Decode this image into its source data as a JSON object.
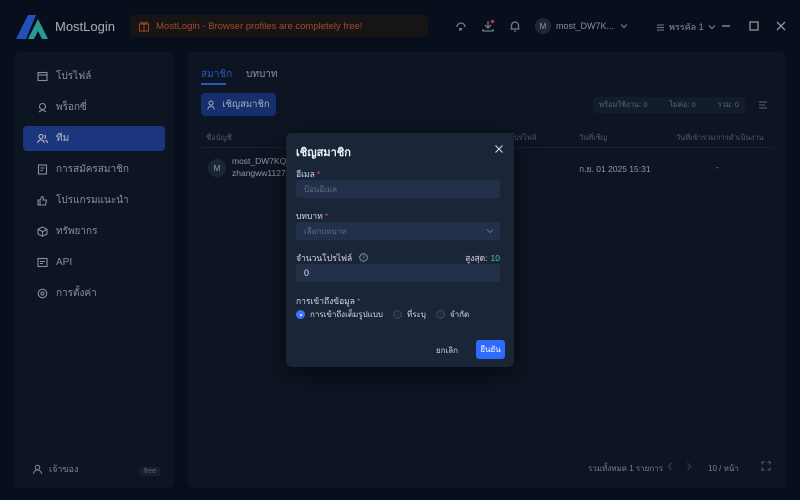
{
  "app": {
    "name": "MostLogin"
  },
  "banner": {
    "text": "MostLogin - Browser profiles are completely free!"
  },
  "topbar": {
    "user": "most_DW7K...",
    "user_initial": "M",
    "workspace": "พรรคัล 1"
  },
  "sidebar": {
    "items": [
      {
        "label": "โปรไฟล์",
        "icon": "window-icon"
      },
      {
        "label": "พร็อกซี่",
        "icon": "proxy-icon"
      },
      {
        "label": "ทีม",
        "icon": "team-icon"
      },
      {
        "label": "การสมัครสมาชิก",
        "icon": "subscription-icon"
      },
      {
        "label": "โปรแกรมแนะนำ",
        "icon": "thumbs-up-icon"
      },
      {
        "label": "ทรัพยากร",
        "icon": "cube-icon"
      },
      {
        "label": "API",
        "icon": "api-icon"
      },
      {
        "label": "การตั้งค่า",
        "icon": "gear-icon"
      }
    ],
    "active_index": 2,
    "owner": "เจ้าของ",
    "plan": "free"
  },
  "main": {
    "tabs": [
      {
        "label": "สมาชิก"
      },
      {
        "label": "บทบาท"
      }
    ],
    "invite_label": "เชิญสมาชิก",
    "stats": {
      "online": "พร้อมใช้งาน: 0",
      "offline": "ไม่ต่อ: 0",
      "total": "รวม: 0"
    },
    "columns": [
      "ชื่อบัญชี",
      "โปรไฟล์",
      "วันที่เชิญ",
      "วันที่เข้าร่วม",
      "การดำเนินงาน"
    ],
    "rows": [
      {
        "initial": "M",
        "name": "most_DW7KQ",
        "email": "zhangww1127",
        "invited": "ก.ย. 01 2025 15:31",
        "action": "-"
      }
    ],
    "footer": {
      "total": "รวมทั้งหมด 1 รายการ",
      "page_size": "10 / หน้า"
    }
  },
  "modal": {
    "title": "เชิญสมาชิก",
    "email": {
      "label": "อีเมล",
      "placeholder": "ป้อนอีเมล"
    },
    "role": {
      "label": "บทบาท",
      "placeholder": "เลือกบทบาท"
    },
    "profile_count": {
      "label": "จำนวนโปรไฟล์",
      "value": "0",
      "max_label": "สูงสุด:",
      "max_value": "10"
    },
    "access": {
      "label": "การเข้าถึงข้อมูล",
      "options": [
        "การเข้าถึงเต็มรูปแบบ",
        "ที่ระบุ",
        "จำกัด"
      ],
      "selected": 0
    },
    "cancel_label": "ยกเลิก",
    "confirm_label": "ยืนยัน"
  }
}
